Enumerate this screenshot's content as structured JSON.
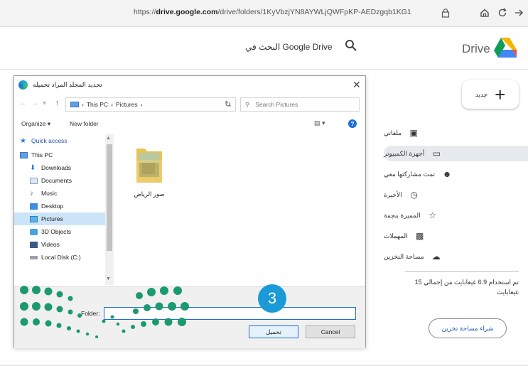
{
  "browser": {
    "url_prefix": "https://",
    "url_domain": "drive.google.com",
    "url_path": "/drive/folders/1KyVbzjYN8AYWLjQWFpKP-AEDzgqb1KG1"
  },
  "drive": {
    "logo_text": "Drive",
    "search_label": "البحث في Google Drive",
    "new_label": "جديد",
    "sidebar": [
      {
        "label": "ملفاتي",
        "icon": "my-drive-icon"
      },
      {
        "label": "أجهزة الكمبيوتر",
        "icon": "computers-icon",
        "selected": true
      },
      {
        "label": "تمت مشاركتها معي",
        "icon": "shared-icon"
      },
      {
        "label": "الأخيرة",
        "icon": "clock-icon"
      },
      {
        "label": "المميزة بنجمة",
        "icon": "star-icon"
      },
      {
        "label": "المهملات",
        "icon": "trash-icon"
      },
      {
        "label": "مساحة التخزين",
        "icon": "cloud-icon"
      }
    ],
    "storage_text": "تم استخدام 6.9 غيغابايت من إجمالي 15 غيغابايت",
    "buy_storage": "شراء مساحة تخزين"
  },
  "dialog": {
    "title": "تحديد المجلد المراد تحميله",
    "path": [
      "This PC",
      "Pictures"
    ],
    "search_placeholder": "Search Pictures",
    "organize": "Organize",
    "new_folder": "New folder",
    "nav_items": [
      {
        "label": "Quick access",
        "icon": "star-icon"
      },
      {
        "label": "This PC",
        "icon": "pc-icon"
      },
      {
        "label": "Downloads",
        "icon": "download-icon"
      },
      {
        "label": "Documents",
        "icon": "documents-icon"
      },
      {
        "label": "Music",
        "icon": "music-icon"
      },
      {
        "label": "Desktop",
        "icon": "desktop-icon"
      },
      {
        "label": "Pictures",
        "icon": "pictures-icon",
        "selected": true
      },
      {
        "label": "3D Objects",
        "icon": "3d-objects-icon"
      },
      {
        "label": "Videos",
        "icon": "videos-icon"
      },
      {
        "label": "Local Disk (C:)",
        "icon": "disk-icon"
      }
    ],
    "folder_name": "صور الرياض",
    "folder_field_label": "Folder:",
    "folder_field_value": "",
    "upload_button": "تحميل",
    "cancel_button": "Cancel"
  },
  "step_number": "3",
  "colors": {
    "accent": "#1a9ad6",
    "selection": "#cce4f7",
    "logo_green": "#1a9a6e"
  }
}
